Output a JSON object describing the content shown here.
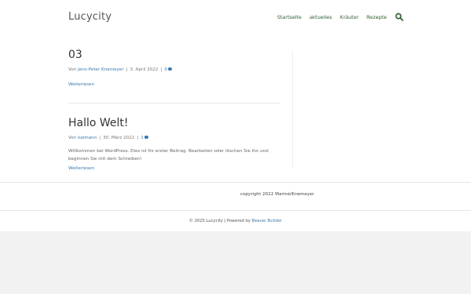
{
  "site": {
    "title": "Lucycity"
  },
  "nav": {
    "items": [
      "Startseite",
      "aktuelles",
      "Kräuter",
      "Rezepte"
    ]
  },
  "posts": [
    {
      "title": "03",
      "meta_prefix": "Von",
      "author": "Jens-Peter Knemeyer",
      "date": "3. April 2022",
      "comments": "0",
      "read_more": "Weiterlesen"
    },
    {
      "title": "Hallo Welt!",
      "meta_prefix": "Von",
      "author": "kaimann",
      "date": "30. März 2022",
      "comments": "1",
      "excerpt": "Willkommen bei WordPress. Dies ist Ihr erster Beitrag. Bearbeiten oder löschen Sie ihn und beginnen Sie mit dem Schreiben!",
      "read_more": "Weiterlesen"
    }
  ],
  "footer": {
    "copyright": "copyright 2022 Marmé/Knemeyer",
    "credit_prefix": "© 2025 Lucycity | Powered by",
    "credit_link": "Beaver Builder"
  },
  "colors": {
    "link": "#3a7ab0",
    "nav": "#2f5f2f",
    "background": "#f2f2f2"
  },
  "icons": {
    "search": "search-icon",
    "comment": "comment-icon"
  }
}
